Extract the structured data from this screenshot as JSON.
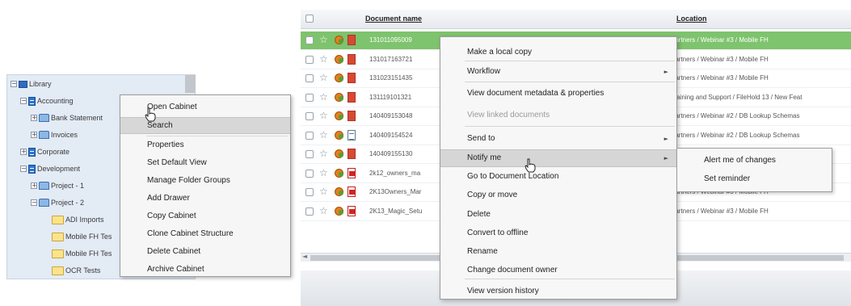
{
  "library_tree": {
    "items": [
      {
        "label": "Library",
        "icon": "library-icon",
        "expander": "−"
      },
      {
        "label": "Accounting",
        "icon": "cabinet-icon",
        "expander": "−"
      },
      {
        "label": "Bank Statement",
        "icon": "drawer-icon",
        "expander": "+"
      },
      {
        "label": "Invoices",
        "icon": "drawer-icon",
        "expander": "+"
      },
      {
        "label": "Corporate",
        "icon": "cabinet-icon",
        "expander": "+"
      },
      {
        "label": "Development",
        "icon": "cabinet-icon",
        "expander": "−"
      },
      {
        "label": "Project - 1",
        "icon": "drawer-icon",
        "expander": "+"
      },
      {
        "label": "Project - 2",
        "icon": "drawer-icon",
        "expander": "−"
      },
      {
        "label": "ADI Imports",
        "icon": "folder-icon",
        "expander": ""
      },
      {
        "label": "Mobile FH Tes",
        "icon": "folder-icon",
        "expander": ""
      },
      {
        "label": "Mobile FH Tes",
        "icon": "folder-icon",
        "expander": ""
      },
      {
        "label": "OCR Tests",
        "icon": "folder-icon",
        "expander": ""
      }
    ]
  },
  "cabinet_menu": {
    "items": [
      "Open Cabinet",
      "Search",
      "Properties",
      "Set Default View",
      "Manage Folder Groups",
      "Add Drawer",
      "Copy Cabinet",
      "Clone Cabinet Structure",
      "Delete Cabinet",
      "Archive Cabinet"
    ],
    "hovered": "Search"
  },
  "grid": {
    "columns": {
      "name": "Document name",
      "location": "Location"
    },
    "rows": [
      {
        "name": "131011095009",
        "location": "Partners / Webinar #3 / Mobile FH",
        "file_type": "image",
        "selected": true
      },
      {
        "name": "131017163721",
        "location": "Partners / Webinar #3 / Mobile FH",
        "file_type": "image",
        "selected": false
      },
      {
        "name": "131023151435",
        "location": "Partners / Webinar #3 / Mobile FH",
        "file_type": "image",
        "selected": false
      },
      {
        "name": "131119101321",
        "location": "Training and Support / FileHold 13 / New Feat",
        "file_type": "image",
        "selected": false
      },
      {
        "name": "140409153048",
        "location": "Partners / Webinar #2 / DB Lookup Schemas",
        "file_type": "image",
        "selected": false
      },
      {
        "name": "140409154524",
        "location": "Partners / Webinar #2 / DB Lookup Schemas",
        "file_type": "doc",
        "selected": false
      },
      {
        "name": "140409155130",
        "location": "Partners / Webinar #2 / DB Lookup Schemas",
        "file_type": "image",
        "selected": false
      },
      {
        "name": "2k12_owners_ma",
        "location": "Partners / Webinar #3 / Mobile FH",
        "file_type": "pdf",
        "selected": false
      },
      {
        "name": "2K13Owners_Mar",
        "location": "Partners / Webinar #3 / Mobile FH",
        "file_type": "pdf",
        "selected": false
      },
      {
        "name": "2K13_Magic_Setu",
        "location": "Partners / Webinar #3 / Mobile FH",
        "file_type": "pdf",
        "selected": false
      }
    ]
  },
  "document_menu": {
    "items": [
      {
        "label": "Make a local copy",
        "submenu": false,
        "disabled": false
      },
      {
        "label": "Workflow",
        "submenu": true,
        "disabled": false
      },
      {
        "label": "View document metadata & properties",
        "submenu": false,
        "disabled": false
      },
      {
        "label": "View linked documents",
        "submenu": false,
        "disabled": true
      },
      {
        "label": "Send to",
        "submenu": true,
        "disabled": false
      },
      {
        "label": "Notify me",
        "submenu": true,
        "disabled": false
      },
      {
        "label": "Go to Document Location",
        "submenu": false,
        "disabled": false
      },
      {
        "label": "Copy or move",
        "submenu": false,
        "disabled": false
      },
      {
        "label": "Delete",
        "submenu": false,
        "disabled": false
      },
      {
        "label": "Convert to offline",
        "submenu": false,
        "disabled": false
      },
      {
        "label": "Rename",
        "submenu": false,
        "disabled": false
      },
      {
        "label": "Change document owner",
        "submenu": false,
        "disabled": false
      },
      {
        "label": "View version history",
        "submenu": false,
        "disabled": false
      }
    ],
    "hovered": "Notify me",
    "arrow_glyph": "►"
  },
  "notify_submenu": {
    "items": [
      "Alert me of changes",
      "Set reminder"
    ]
  },
  "colors": {
    "selected_row": "#7ec36d",
    "tree_background": "#e3ebf5",
    "menu_hover": "#d6d6d6"
  }
}
